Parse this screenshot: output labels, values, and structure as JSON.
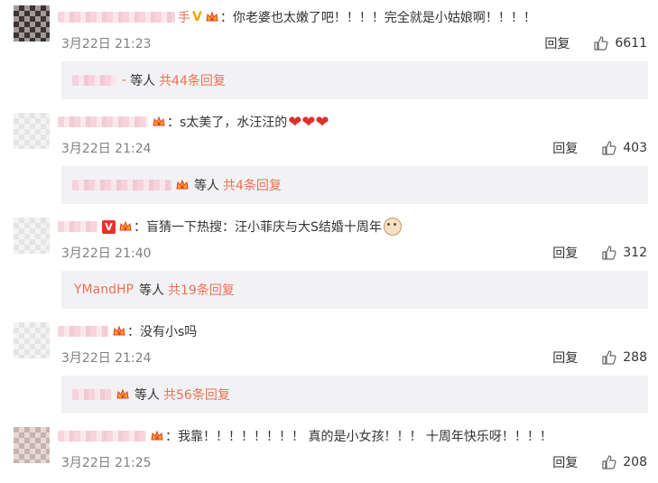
{
  "comments": [
    {
      "user_suffix": "手",
      "sep": "：",
      "text": "你老婆也太嫩了吧！！！！完全就是小姑娘啊！！！！",
      "time": "3月22日 21:23",
      "reply_label": "回复",
      "likes": "6611",
      "replies": {
        "dash": "-",
        "text": "等人",
        "count": "共44条回复"
      }
    },
    {
      "sep": "：",
      "text": "s太美了，水汪汪的",
      "hearts": "❤❤❤",
      "time": "3月22日 21:24",
      "reply_label": "回复",
      "likes": "403",
      "replies": {
        "text": "等人",
        "count": "共4条回复"
      }
    },
    {
      "badge": "V",
      "sep": "：",
      "text": "盲猜一下热搜：汪小菲庆与大S结婚十周年",
      "time": "3月22日 21:40",
      "reply_label": "回复",
      "likes": "312",
      "replies": {
        "user": "YMandHP",
        "text": "等人",
        "count": "共19条回复"
      }
    },
    {
      "sep": "：",
      "text": "没有小s吗",
      "time": "3月22日 21:24",
      "reply_label": "回复",
      "likes": "288",
      "replies": {
        "text": "等人",
        "count": "共56条回复"
      }
    },
    {
      "sep": "：",
      "text": "我靠！！！！！！！！ 真的是小女孩！！！ 十周年快乐呀！！！！",
      "time": "3月22日 21:25",
      "reply_label": "回复",
      "likes": "208"
    }
  ]
}
